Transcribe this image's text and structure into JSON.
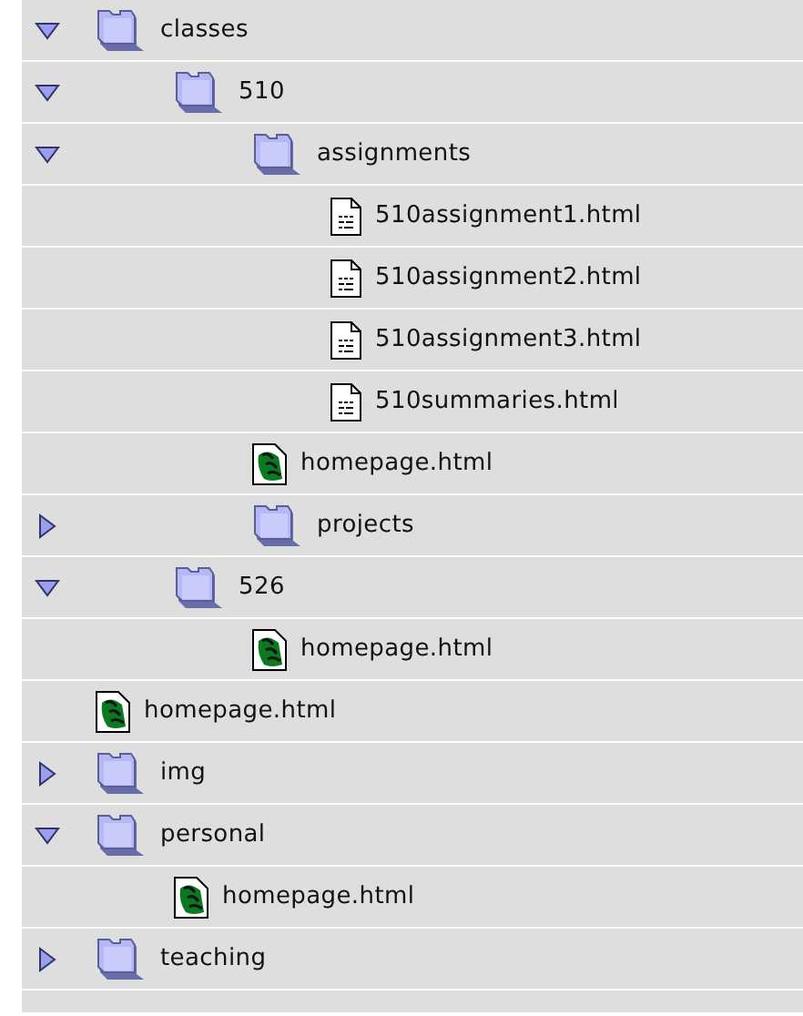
{
  "tree": [
    {
      "kind": "folder",
      "name": "classes",
      "expanded": true,
      "children": [
        {
          "kind": "folder",
          "name": "510",
          "expanded": true,
          "children": [
            {
              "kind": "folder",
              "name": "assignments",
              "expanded": true,
              "children": [
                {
                  "kind": "document",
                  "name": "510assignment1.html"
                },
                {
                  "kind": "document",
                  "name": "510assignment2.html"
                },
                {
                  "kind": "document",
                  "name": "510assignment3.html"
                },
                {
                  "kind": "document",
                  "name": "510summaries.html"
                }
              ]
            },
            {
              "kind": "webpage",
              "name": "homepage.html"
            },
            {
              "kind": "folder",
              "name": "projects",
              "expanded": false
            }
          ]
        },
        {
          "kind": "folder",
          "name": "526",
          "expanded": true,
          "children": [
            {
              "kind": "webpage",
              "name": "homepage.html"
            }
          ]
        }
      ]
    },
    {
      "kind": "webpage",
      "name": "homepage.html"
    },
    {
      "kind": "folder",
      "name": "img",
      "expanded": false
    },
    {
      "kind": "folder",
      "name": "personal",
      "expanded": true,
      "children": [
        {
          "kind": "webpage",
          "name": "homepage.html"
        }
      ]
    },
    {
      "kind": "folder",
      "name": "teaching",
      "expanded": false
    }
  ]
}
